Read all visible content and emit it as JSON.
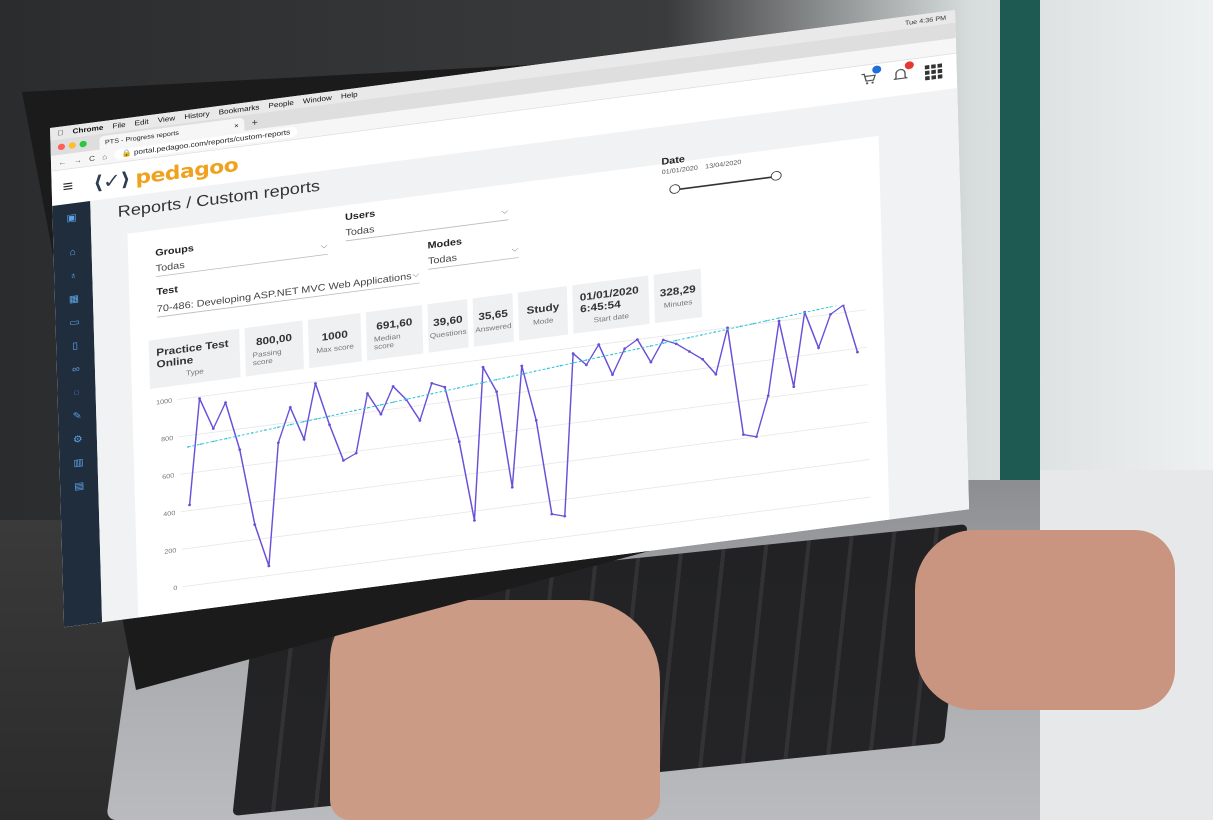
{
  "os_menubar": {
    "apple": "",
    "app": "Chrome",
    "menus": [
      "File",
      "Edit",
      "View",
      "History",
      "Bookmarks",
      "People",
      "Window",
      "Help"
    ],
    "status": "Tue 4:36 PM"
  },
  "browser": {
    "tab_title": "PTS - Progress reports",
    "close": "×",
    "new_tab": "+",
    "url": "portal.pedagoo.com/reports/custom-reports",
    "nav": {
      "back": "←",
      "forward": "→",
      "reload": "C",
      "home": "⌂",
      "lock": "🔒"
    }
  },
  "header": {
    "logo_mark": "⟨✓⟩",
    "logo_text": "pedagoo",
    "menu": "≡",
    "cart_color": "#1e6fd9",
    "bell_color": "#e53935"
  },
  "sidebar": {
    "icons": [
      "folder-icon",
      "home-icon",
      "microphone-icon",
      "grid-icon",
      "card-icon",
      "mobile-icon",
      "infinity-icon",
      "chat-icon",
      "edit-icon",
      "gear-icon",
      "bar-chart-icon",
      "archive-icon"
    ],
    "accent": "#5ea2e8"
  },
  "page": {
    "title": "Reports / Custom reports"
  },
  "filters": {
    "groups_label": "Groups",
    "groups_value": "Todas",
    "users_label": "Users",
    "users_value": "Todas",
    "modes_label": "Modes",
    "modes_value": "Todas",
    "test_label": "Test",
    "test_value": "70-486: Developing ASP.NET MVC Web Applications",
    "date_label": "Date",
    "date_from": "01/01/2020",
    "date_to": "13/04/2020"
  },
  "stats": [
    {
      "value": "Practice Test Online",
      "label": "Type"
    },
    {
      "value": "800,00",
      "label": "Passing score"
    },
    {
      "value": "1000",
      "label": "Max score"
    },
    {
      "value": "691,60",
      "label": "Median score"
    },
    {
      "value": "39,60",
      "label": "Questions"
    },
    {
      "value": "35,65",
      "label": "Answered"
    },
    {
      "value": "Study",
      "label": "Mode"
    },
    {
      "value": "01/01/2020 6:45:54",
      "label": "Start date"
    },
    {
      "value": "328,29",
      "label": "Minutes"
    }
  ],
  "chart_data": {
    "type": "line",
    "ylim": [
      0,
      1000
    ],
    "y_ticks": [
      "0",
      "200",
      "400",
      "600",
      "800",
      "1000"
    ],
    "series": [
      {
        "values": [
          430,
          990,
          820,
          950,
          690,
          280,
          50,
          700,
          880,
          700,
          990,
          760,
          560,
          590,
          900,
          780,
          920,
          840,
          720,
          910,
          880,
          580,
          150,
          960,
          820,
          300,
          940,
          640,
          130,
          110,
          970,
          900,
          1000,
          830,
          960,
          1000,
          870,
          980,
          950,
          900,
          850,
          760,
          1000,
          420,
          400,
          610,
          1000,
          640,
          1030,
          830,
          1000,
          1040,
          780
        ]
      },
      {
        "values": [
          740,
          746,
          752,
          758,
          764,
          770,
          776,
          782,
          788,
          794,
          800,
          806,
          812,
          818,
          824,
          830,
          836,
          842,
          848,
          854,
          860,
          866,
          872,
          878,
          884,
          890,
          896,
          902,
          908,
          914,
          920,
          926,
          932,
          938,
          944,
          950,
          956,
          962,
          968,
          974,
          980,
          986,
          992,
          998,
          1004,
          1010,
          1016,
          1022,
          1028,
          1034,
          1040,
          1046,
          1052
        ]
      }
    ],
    "series_colors": [
      "#6a4fd8",
      "#29c1d8"
    ]
  }
}
